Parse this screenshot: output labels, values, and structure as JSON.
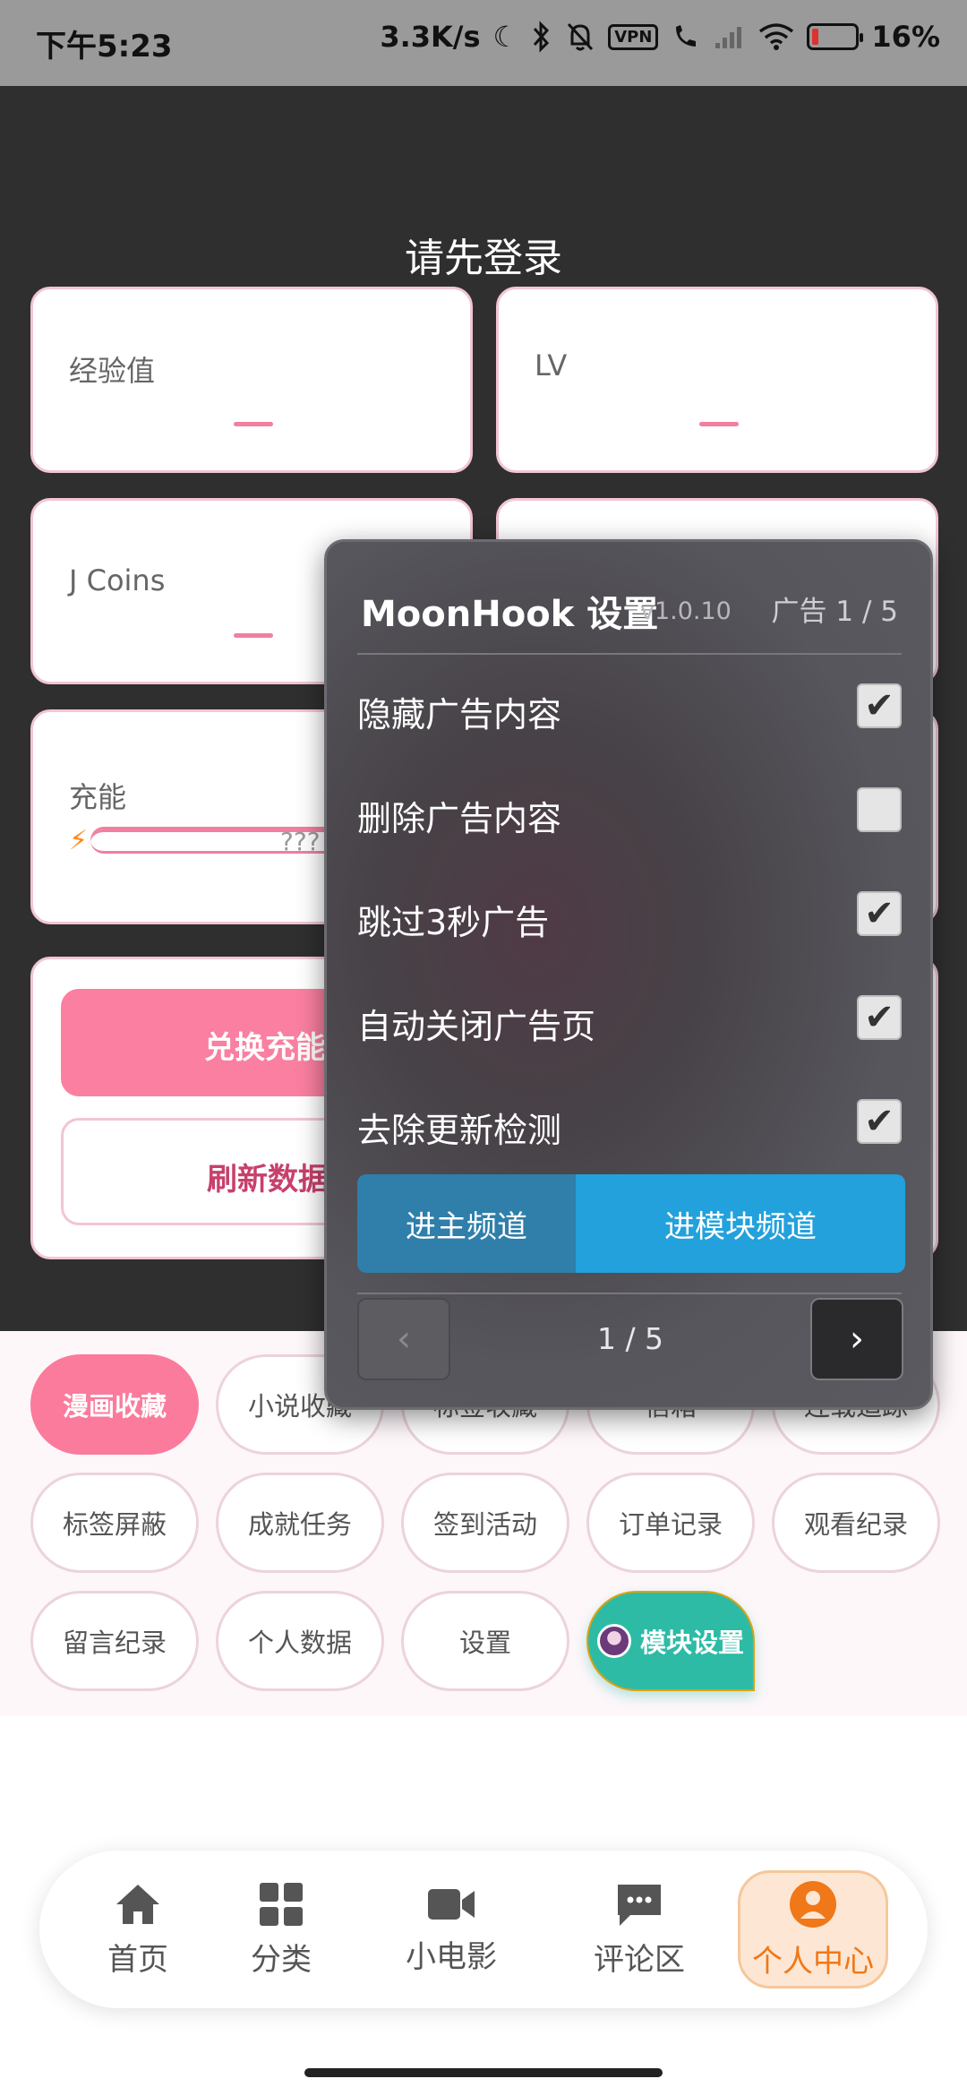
{
  "status_bar": {
    "time": "下午5:23",
    "net_speed": "3.3K/s",
    "vpn": "VPN",
    "battery": "16%",
    "battery_level": 0.16,
    "icons": [
      "moon-icon",
      "bluetooth-icon",
      "mute-bell-icon",
      "vpn-icon",
      "call-icon",
      "signal-icon",
      "wifi-icon",
      "battery-icon"
    ]
  },
  "profile": {
    "title": "请先登录",
    "stats": [
      {
        "label": "经验值",
        "value": "—"
      },
      {
        "label": "LV",
        "value": "—"
      },
      {
        "label": "J Coins",
        "value": "—"
      },
      {
        "label": "充能",
        "value": "???"
      }
    ],
    "exchange_button": "兑换充能",
    "refresh_button": "刷新数据"
  },
  "chips": [
    {
      "label": "漫画收藏",
      "active": true
    },
    {
      "label": "小说收藏"
    },
    {
      "label": "标签收藏"
    },
    {
      "label": "信箱"
    },
    {
      "label": "连载追踪"
    },
    {
      "label": "标签屏蔽"
    },
    {
      "label": "成就任务"
    },
    {
      "label": "签到活动"
    },
    {
      "label": "订单记录"
    },
    {
      "label": "观看纪录"
    },
    {
      "label": "留言纪录"
    },
    {
      "label": "个人数据"
    },
    {
      "label": "设置"
    },
    {
      "label": "模块设置",
      "module": true
    }
  ],
  "dialog": {
    "title": "MoonHook 设置",
    "version": "v1.0.10",
    "page_indicator": "广告 1 / 5",
    "options": [
      {
        "label": "隐藏广告内容",
        "checked": true
      },
      {
        "label": "删除广告内容",
        "checked": false
      },
      {
        "label": "跳过3秒广告",
        "checked": true
      },
      {
        "label": "自动关闭广告页",
        "checked": true
      },
      {
        "label": "去除更新检测",
        "checked": true
      }
    ],
    "main_channel_button": "进主频道",
    "module_channel_button": "进模块频道",
    "pager": {
      "prev": "‹",
      "label": "1 / 5",
      "next": "›"
    }
  },
  "bottom_nav": [
    {
      "label": "首页",
      "icon": "home-icon"
    },
    {
      "label": "分类",
      "icon": "grid-icon"
    },
    {
      "label": "小电影",
      "icon": "video-camera-icon"
    },
    {
      "label": "评论区",
      "icon": "comment-icon"
    },
    {
      "label": "个人中心",
      "icon": "user-icon",
      "active": true
    }
  ],
  "colors": {
    "accent_pink": "#fa7fa0",
    "module_teal": "#2dbba6",
    "nav_active": "#f07818",
    "dialog_blue": "#22a1dc"
  }
}
